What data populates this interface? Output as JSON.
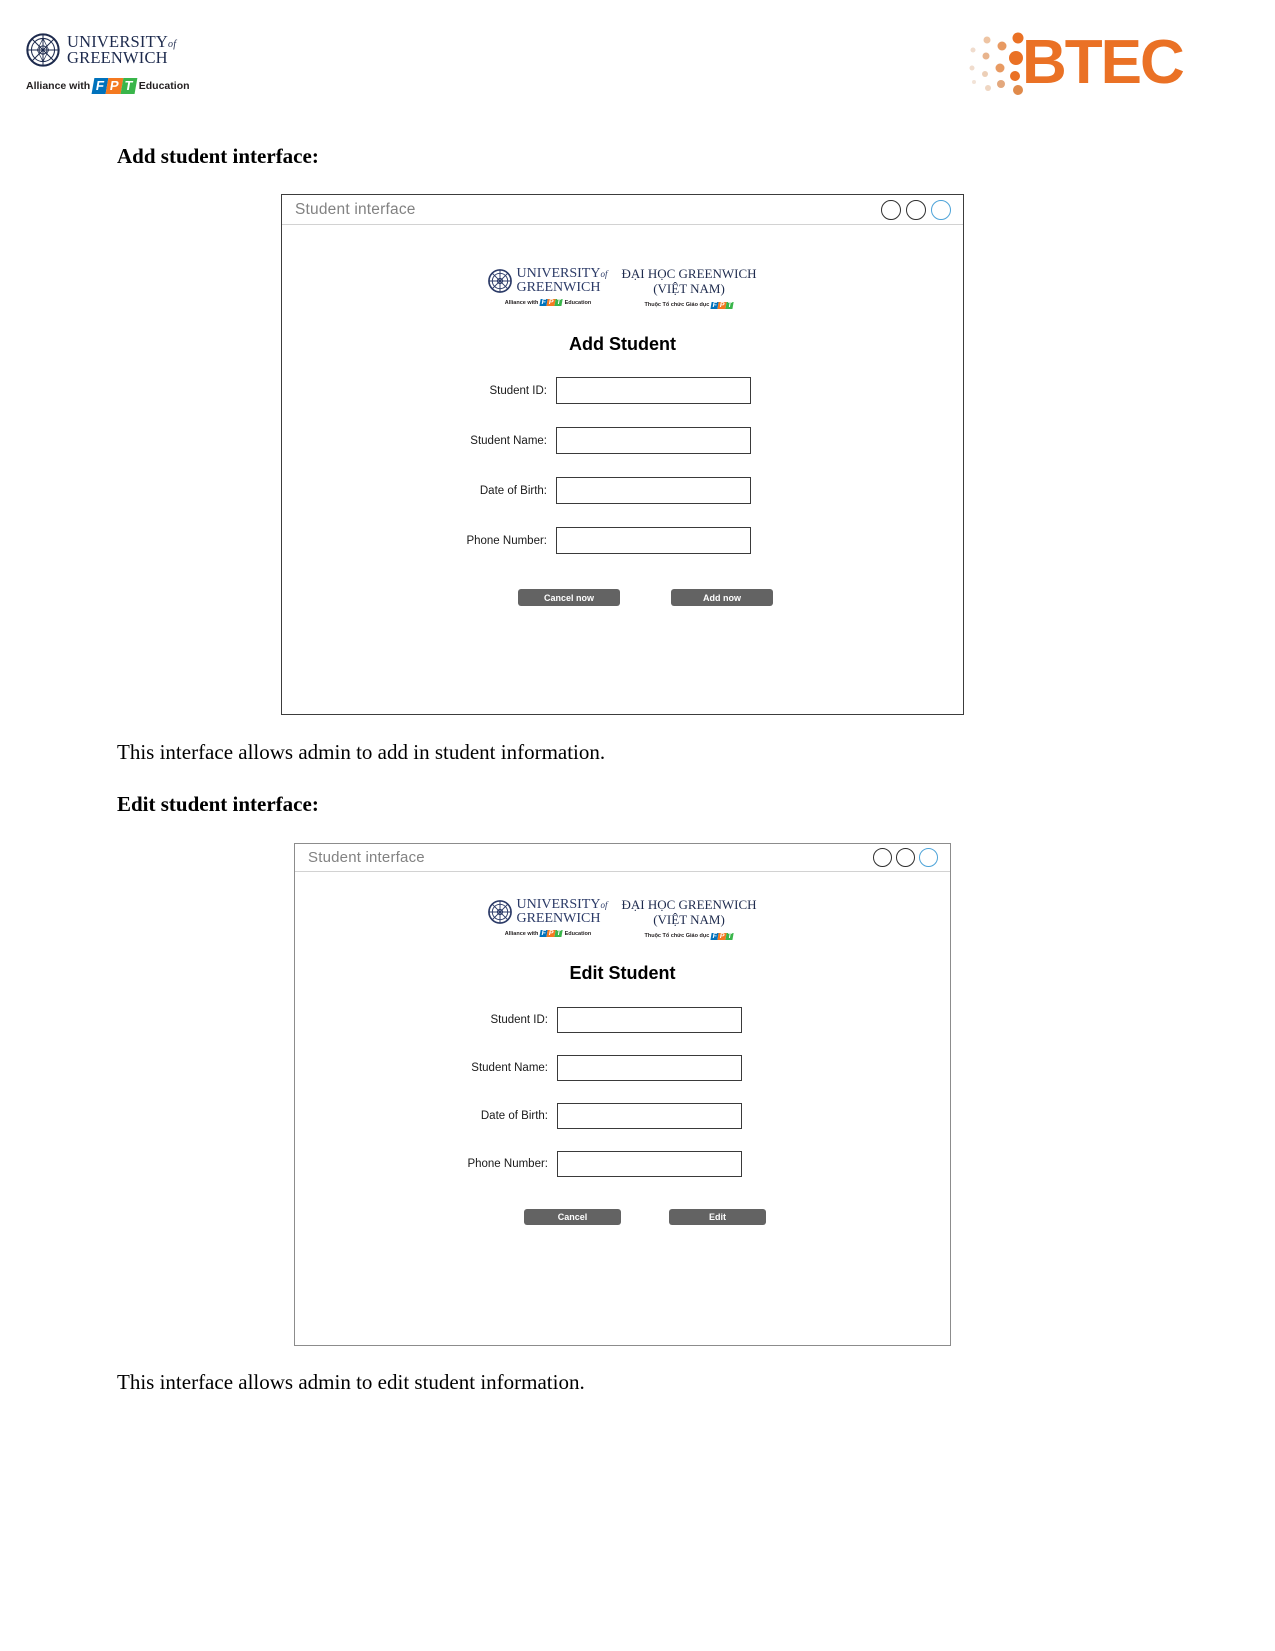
{
  "header": {
    "university_logo": {
      "line1": "UNIVERSITY",
      "of": "of",
      "line2": "GREENWICH",
      "alliance_prefix": "Alliance with",
      "fpt_f": "F",
      "fpt_p": "P",
      "fpt_t": "T",
      "alliance_suffix": "Education"
    },
    "btec_logo": {
      "text": "BTEC",
      "color": "#ea7125"
    }
  },
  "sections": [
    {
      "heading": "Add student interface:",
      "caption": "This interface allows admin to add in student information.",
      "window": {
        "title": "Student interface",
        "controls": [
          "minimize-circle",
          "maximize-circle",
          "close-circle"
        ],
        "brand": {
          "uog_line1": "UNIVERSITY",
          "uog_of": "of",
          "uog_line2": "GREENWICH",
          "uog_sub_prefix": "Alliance with",
          "uog_sub_suffix": "Education",
          "vn_line1": "ĐẠI HỌC GREENWICH",
          "vn_line2": "(VIỆT NAM)",
          "vn_sub": "Thuộc Tổ chức Giáo dục"
        },
        "form_title": "Add Student",
        "fields": [
          {
            "label": "Student ID:",
            "value": "",
            "placeholder": ""
          },
          {
            "label": "Student Name:",
            "value": "",
            "placeholder": ""
          },
          {
            "label": "Date of Birth:",
            "value": "",
            "placeholder": ""
          },
          {
            "label": "Phone Number:",
            "value": "",
            "placeholder": ""
          }
        ],
        "buttons": [
          {
            "label": "Cancel now",
            "color": "#636363"
          },
          {
            "label": "Add now",
            "color": "#636363"
          }
        ]
      }
    },
    {
      "heading": "Edit student interface:",
      "caption": "This interface allows admin to edit student information.",
      "window": {
        "title": "Student interface",
        "controls": [
          "minimize-circle",
          "maximize-circle",
          "close-circle"
        ],
        "brand": {
          "uog_line1": "UNIVERSITY",
          "uog_of": "of",
          "uog_line2": "GREENWICH",
          "uog_sub_prefix": "Alliance with",
          "uog_sub_suffix": "Education",
          "vn_line1": "ĐẠI HỌC GREENWICH",
          "vn_line2": "(VIỆT NAM)",
          "vn_sub": "Thuộc Tổ chức Giáo dục"
        },
        "form_title": "Edit Student",
        "fields": [
          {
            "label": "Student ID:",
            "value": "",
            "placeholder": ""
          },
          {
            "label": "Student Name:",
            "value": "",
            "placeholder": ""
          },
          {
            "label": "Date of Birth:",
            "value": "",
            "placeholder": ""
          },
          {
            "label": "Phone Number:",
            "value": "",
            "placeholder": ""
          }
        ],
        "buttons": [
          {
            "label": "Cancel",
            "color": "#636363"
          },
          {
            "label": "Edit",
            "color": "#636363"
          }
        ]
      }
    }
  ]
}
